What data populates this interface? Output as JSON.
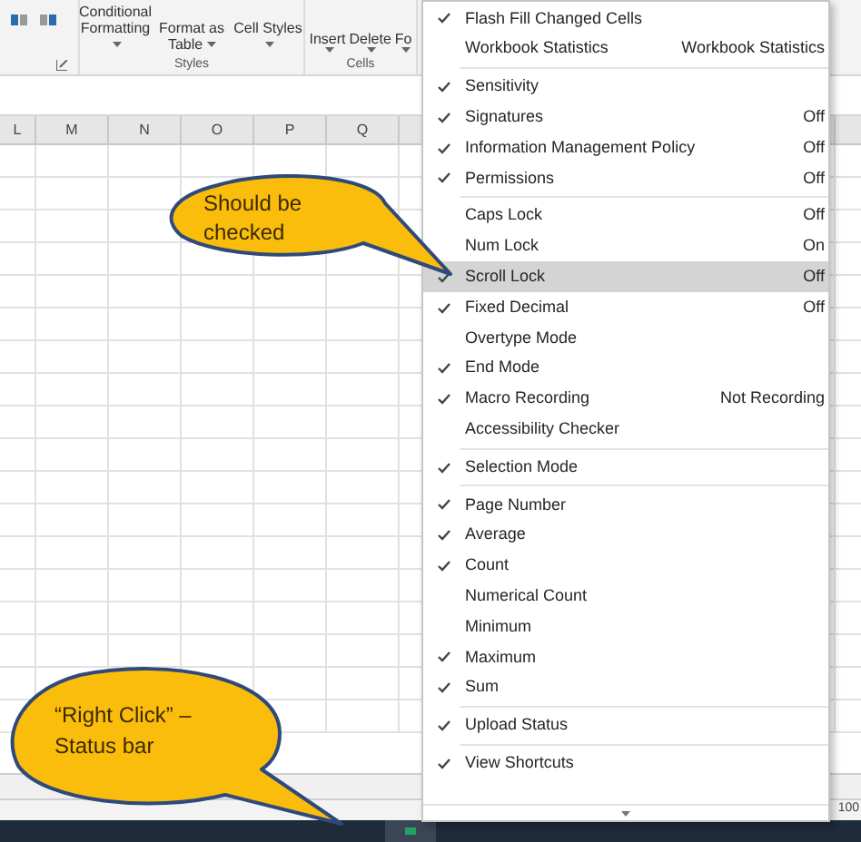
{
  "ribbon": {
    "groups": [
      {
        "label": "Styles",
        "buttons": [
          "Conditional Formatting",
          "Format as Table",
          "Cell Styles"
        ]
      },
      {
        "label": "Cells",
        "buttons": [
          "Insert",
          "Delete",
          "Fo"
        ]
      }
    ]
  },
  "sheet": {
    "columns": [
      "L",
      "M",
      "N",
      "O",
      "P",
      "Q"
    ]
  },
  "status_bar": {
    "zoom": "100"
  },
  "menu": {
    "sections": [
      {
        "items": [
          {
            "label": "Flash Fill Changed Cells",
            "checked": true,
            "selected": false
          },
          {
            "label": "Workbook Statistics",
            "value": "Workbook Statistics",
            "checked": false,
            "selected": false
          }
        ]
      },
      {
        "items": [
          {
            "label": "Sensitivity",
            "checked": true,
            "selected": false
          },
          {
            "label": "Signatures",
            "value": "Off",
            "checked": true,
            "selected": false
          },
          {
            "label": "Information Management Policy",
            "value": "Off",
            "checked": true,
            "selected": false
          },
          {
            "label": "Permissions",
            "value": "Off",
            "checked": true,
            "selected": false
          }
        ]
      },
      {
        "items": [
          {
            "label": "Caps Lock",
            "value": "Off",
            "checked": false,
            "selected": false
          },
          {
            "label": "Num Lock",
            "value": "On",
            "checked": false,
            "selected": false
          },
          {
            "label": "Scroll Lock",
            "value": "Off",
            "checked": true,
            "selected": true
          },
          {
            "label": "Fixed Decimal",
            "value": "Off",
            "checked": true,
            "selected": false
          },
          {
            "label": "Overtype Mode",
            "checked": false,
            "selected": false
          },
          {
            "label": "End Mode",
            "checked": true,
            "selected": false
          },
          {
            "label": "Macro Recording",
            "value": "Not Recording",
            "checked": true,
            "selected": false
          },
          {
            "label": "Accessibility Checker",
            "checked": false,
            "selected": false
          }
        ]
      },
      {
        "items": [
          {
            "label": "Selection Mode",
            "checked": true,
            "selected": false
          }
        ]
      },
      {
        "items": [
          {
            "label": "Page Number",
            "checked": true,
            "selected": false
          },
          {
            "label": "Average",
            "checked": true,
            "selected": false
          },
          {
            "label": "Count",
            "checked": true,
            "selected": false
          },
          {
            "label": "Numerical Count",
            "checked": false,
            "selected": false
          },
          {
            "label": "Minimum",
            "checked": false,
            "selected": false
          },
          {
            "label": "Maximum",
            "checked": true,
            "selected": false
          },
          {
            "label": "Sum",
            "checked": true,
            "selected": false
          }
        ]
      },
      {
        "items": [
          {
            "label": "Upload Status",
            "checked": true,
            "selected": false
          }
        ]
      },
      {
        "items": [
          {
            "label": "View Shortcuts",
            "checked": true,
            "selected": false
          }
        ]
      }
    ]
  },
  "callouts": [
    {
      "text": "Should be checked"
    },
    {
      "text": "“Right Click” – Status bar"
    }
  ]
}
